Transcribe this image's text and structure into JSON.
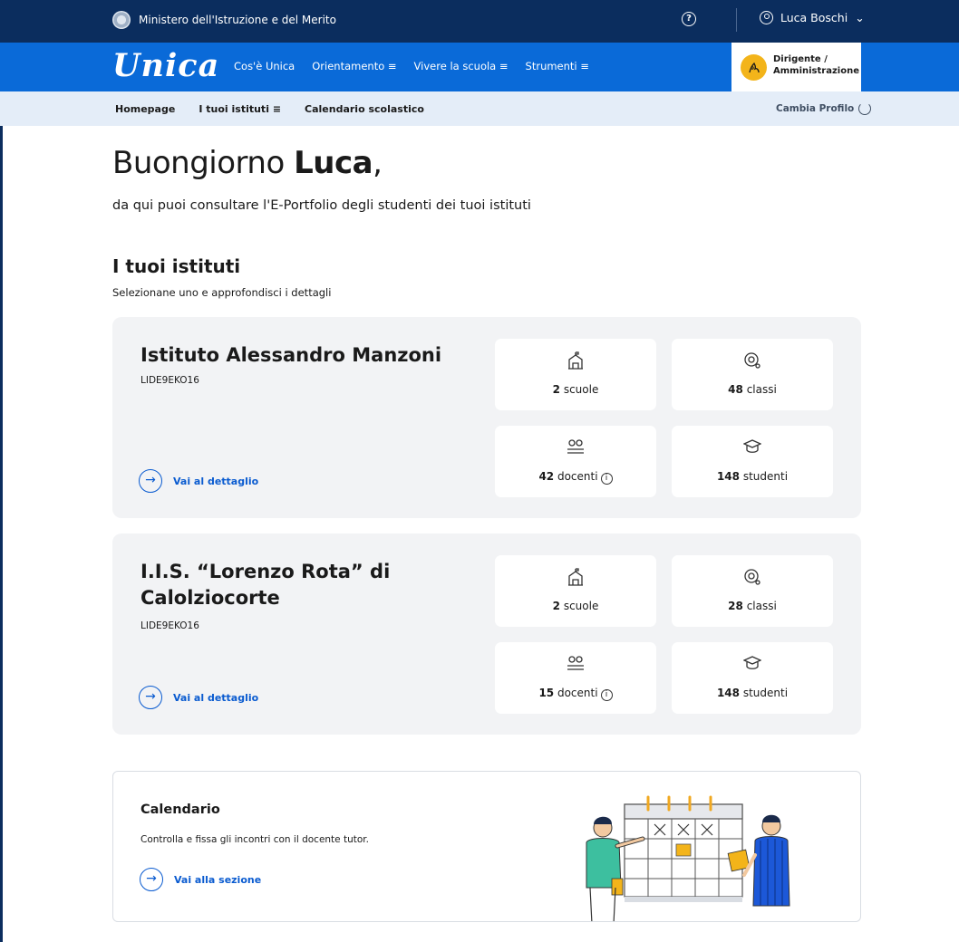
{
  "topbar": {
    "ministry": "Ministero dell'Istruzione e del Merito",
    "help_icon": "?",
    "user_name": "Luca Boschi",
    "user_chevron": "⌄"
  },
  "nav": {
    "logo": "Unica",
    "links": [
      {
        "label": "Cos'è Unica",
        "menu": ""
      },
      {
        "label": "Orientamento",
        "menu": "≡"
      },
      {
        "label": "Vivere la scuola",
        "menu": "≡"
      },
      {
        "label": "Strumenti",
        "menu": "≡"
      }
    ],
    "profile_role_1": "Dirigente /",
    "profile_role_2": "Amministrazione"
  },
  "subnav": {
    "homepage": "Homepage",
    "istituti": "I tuoi istituti",
    "istituti_menu": "≡",
    "calendario": "Calendario scolastico",
    "switch": "Cambia Profilo"
  },
  "hero": {
    "greeting": "Buongiorno",
    "name": "Luca",
    "comma": ",",
    "intro": "da qui puoi consultare l'E-Portfolio degli studenti dei tuoi istituti"
  },
  "section": {
    "title": "I tuoi istituti",
    "subtitle": "Selezionane uno e approfondisci i dettagli"
  },
  "institutes": [
    {
      "name": "Istituto Alessandro Manzoni",
      "code": "LIDE9EKO16",
      "detail_label": "Vai al dettaglio",
      "scuole_num": "2",
      "scuole_label": "scuole",
      "classi_num": "48",
      "classi_label": "classi",
      "docenti_num": "42",
      "docenti_label": "docenti",
      "studenti_num": "148",
      "studenti_label": "studenti"
    },
    {
      "name": "I.I.S. “Lorenzo Rota” di Calolziocorte",
      "code": "LIDE9EKO16",
      "detail_label": "Vai al dettaglio",
      "scuole_num": "2",
      "scuole_label": "scuole",
      "classi_num": "28",
      "classi_label": "classi",
      "docenti_num": "15",
      "docenti_label": "docenti",
      "studenti_num": "148",
      "studenti_label": "studenti"
    }
  ],
  "calendar": {
    "title": "Calendario",
    "subtitle": "Controlla e fissa gli incontri con il docente tutor.",
    "link": "Vai alla sezione"
  },
  "icons": {
    "arrow": "→",
    "info": "i",
    "school": "school-building-icon",
    "class": "class-icon",
    "teachers": "teachers-icon",
    "students": "graduation-cap-icon"
  },
  "colors": {
    "topbar": "#0b2d5e",
    "nav": "#0a6ad8",
    "subnav": "#e4edf8",
    "accent": "#0a5bd0",
    "avatar": "#f3b41a",
    "card": "#f2f3f5"
  }
}
